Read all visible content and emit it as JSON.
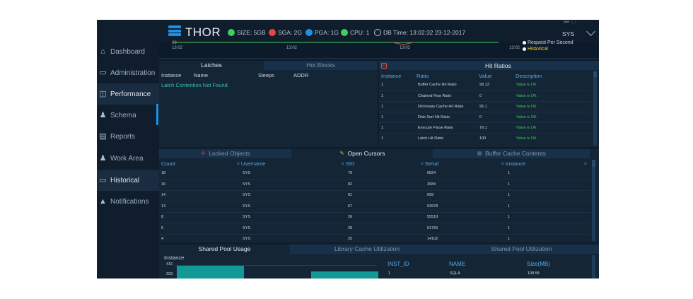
{
  "header": {
    "brand": "THOR",
    "size": "SIZE: 5GB",
    "sga": "SGA: 2G",
    "pga": "PGA: 1G",
    "cpu": "CPU: 1",
    "db_time": "DB Time: 13:02:32 23-12-2017",
    "user": "SYS",
    "colors": {
      "size": "#3fcf5a",
      "sga": "#e5473f",
      "pga": "#1e90e6",
      "cpu": "#3fcf5a"
    }
  },
  "sidebar": {
    "items": [
      {
        "label": "Dashboard",
        "icon": "home-icon"
      },
      {
        "label": "Administration",
        "icon": "monitor-icon"
      },
      {
        "label": "Performance",
        "icon": "performance-icon"
      },
      {
        "label": "Schema",
        "icon": "users-icon"
      },
      {
        "label": "Reports",
        "icon": "report-icon"
      },
      {
        "label": "Work Area",
        "icon": "group-icon"
      },
      {
        "label": "Historical",
        "icon": "monitor-icon"
      },
      {
        "label": "Notifications",
        "icon": "bell-icon"
      }
    ],
    "active": [
      "Performance",
      "Historical"
    ]
  },
  "chart_strip": {
    "y_tick": "00",
    "x_ticks": [
      "13:02",
      "13:02",
      "13:02",
      "13:02"
    ],
    "legend": [
      "Request Per Second",
      "Historical"
    ],
    "legend_colors": [
      "#ffffff",
      "#f2d33a"
    ]
  },
  "latches": {
    "tabs": [
      "Latches",
      "Hot Blocks"
    ],
    "columns": [
      "Instance",
      "Name",
      "Sleeps",
      "ADDR"
    ],
    "message": "Latch Contention Not Found"
  },
  "hit_ratios": {
    "title": "Hit Ratios",
    "columns": [
      "Instance",
      "Ratio",
      "Value",
      "Description"
    ],
    "rows": [
      {
        "instance": "1",
        "ratio": "Buffer Cache Hit Ratio",
        "value": "99.13",
        "desc": "Value is OK"
      },
      {
        "instance": "1",
        "ratio": "Chained Row Ratio",
        "value": "0",
        "desc": "Value is OK"
      },
      {
        "instance": "1",
        "ratio": "Dictionary Cache Hit Ratio",
        "value": "95.1",
        "desc": "Value is OK"
      },
      {
        "instance": "1",
        "ratio": "Disk Sort Hit Ratio",
        "value": "0",
        "desc": "Value is OK"
      },
      {
        "instance": "1",
        "ratio": "Execute Parse Ratio",
        "value": "79.1",
        "desc": "Value is OK"
      },
      {
        "instance": "1",
        "ratio": "Latch Hit Ratio",
        "value": "100",
        "desc": "Value is OK"
      }
    ]
  },
  "cursors": {
    "tabs": [
      "Locked Objects",
      "Open Cursors",
      "Buffer Cache Contents"
    ],
    "columns": [
      "Count",
      "Username",
      "SID",
      "Serial",
      "Instance"
    ],
    "rows": [
      [
        "18",
        "SYS",
        "76",
        "6824",
        "1"
      ],
      [
        "16",
        "SYS",
        "82",
        "3084",
        "1"
      ],
      [
        "14",
        "SYS",
        "81",
        "699",
        "1"
      ],
      [
        "13",
        "SYS",
        "67",
        "63978",
        "1"
      ],
      [
        "8",
        "SYS",
        "26",
        "55519",
        "1"
      ],
      [
        "5",
        "SYS",
        "28",
        "51756",
        "1"
      ],
      [
        "4",
        "SYS",
        "25",
        "14102",
        "1"
      ]
    ]
  },
  "pool": {
    "tabs": [
      "Shared Pool Usage",
      "Library Cache Utilization",
      "Shared Pool Utilization"
    ],
    "chart_label": "Instance",
    "y_ticks": [
      "416",
      "333"
    ],
    "columns": [
      "INST_ID",
      "NAME",
      "Size(MB)"
    ],
    "rows": [
      {
        "inst_id": "1",
        "name": "SQLA",
        "size": "108.58"
      }
    ]
  },
  "pool_chart_data": {
    "type": "bar",
    "y_ticks": [
      416,
      333
    ],
    "values": [
      416,
      320
    ]
  }
}
